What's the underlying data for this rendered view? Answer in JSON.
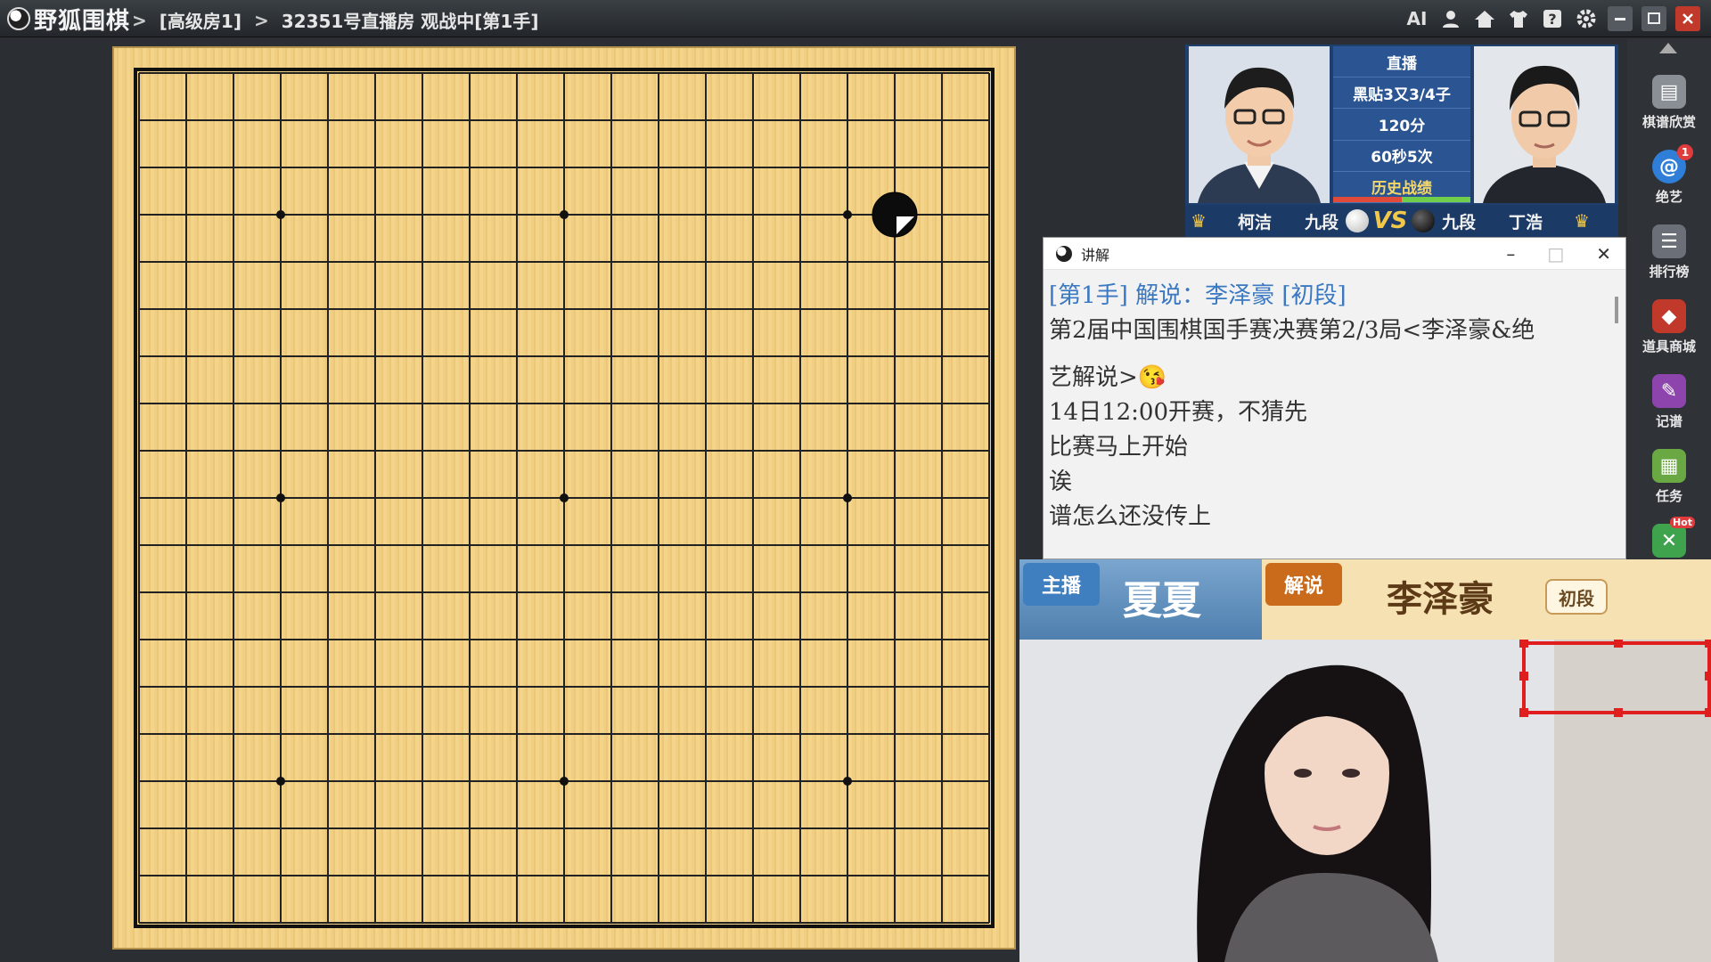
{
  "titlebar": {
    "app_name": "野狐围棋",
    "breadcrumbs": [
      "[高级房1]",
      "32351号直播房 观战中[第1手]"
    ],
    "separator": ">",
    "ai_label": "AI"
  },
  "match": {
    "left_player": {
      "name": "柯洁",
      "rank": "九段",
      "stone": "white"
    },
    "right_player": {
      "name": "丁浩",
      "rank": "九段",
      "stone": "black"
    },
    "vs_label": "VS",
    "info": [
      "直播",
      "黑贴3又3/4子",
      "120分",
      "60秒5次"
    ],
    "history_label": "历史战绩"
  },
  "board": {
    "size": 19,
    "stones": [
      {
        "col": 16,
        "row": 3,
        "color": "black",
        "last_move": true
      }
    ]
  },
  "sidebar": {
    "items": [
      {
        "label": "棋谱欣赏",
        "icon": "book-icon"
      },
      {
        "label": "绝艺",
        "icon": "ai-spiral-icon",
        "badge": "1"
      },
      {
        "label": "排行榜",
        "icon": "list-icon"
      },
      {
        "label": "道具商城",
        "icon": "gem-icon"
      },
      {
        "label": "记谱",
        "icon": "pen-icon"
      },
      {
        "label": "任务",
        "icon": "grid-icon"
      },
      {
        "label": "",
        "icon": "hot-icon",
        "badge": "Hot"
      }
    ]
  },
  "commentary": {
    "window_title": "讲解",
    "header_line": "[第1手] 解说：李泽豪 [初段]",
    "lines": [
      "第2届中国围棋国手赛决赛第2/3局<李泽豪&绝",
      "艺解说>😘",
      "14日12:00开赛，不猜先",
      "比赛马上开始",
      "诶",
      "谱怎么还没传上"
    ]
  },
  "stream": {
    "host_tag": "主播",
    "host_name": "夏夏",
    "commentator_tag": "解说",
    "commentator_name": "李泽豪",
    "commentator_rank": "初段"
  },
  "colors": {
    "board": "#f0cf82",
    "host_blue": "#3f7fbf",
    "commentator_orange": "#c96b1a",
    "link_blue": "#3a78c2"
  }
}
